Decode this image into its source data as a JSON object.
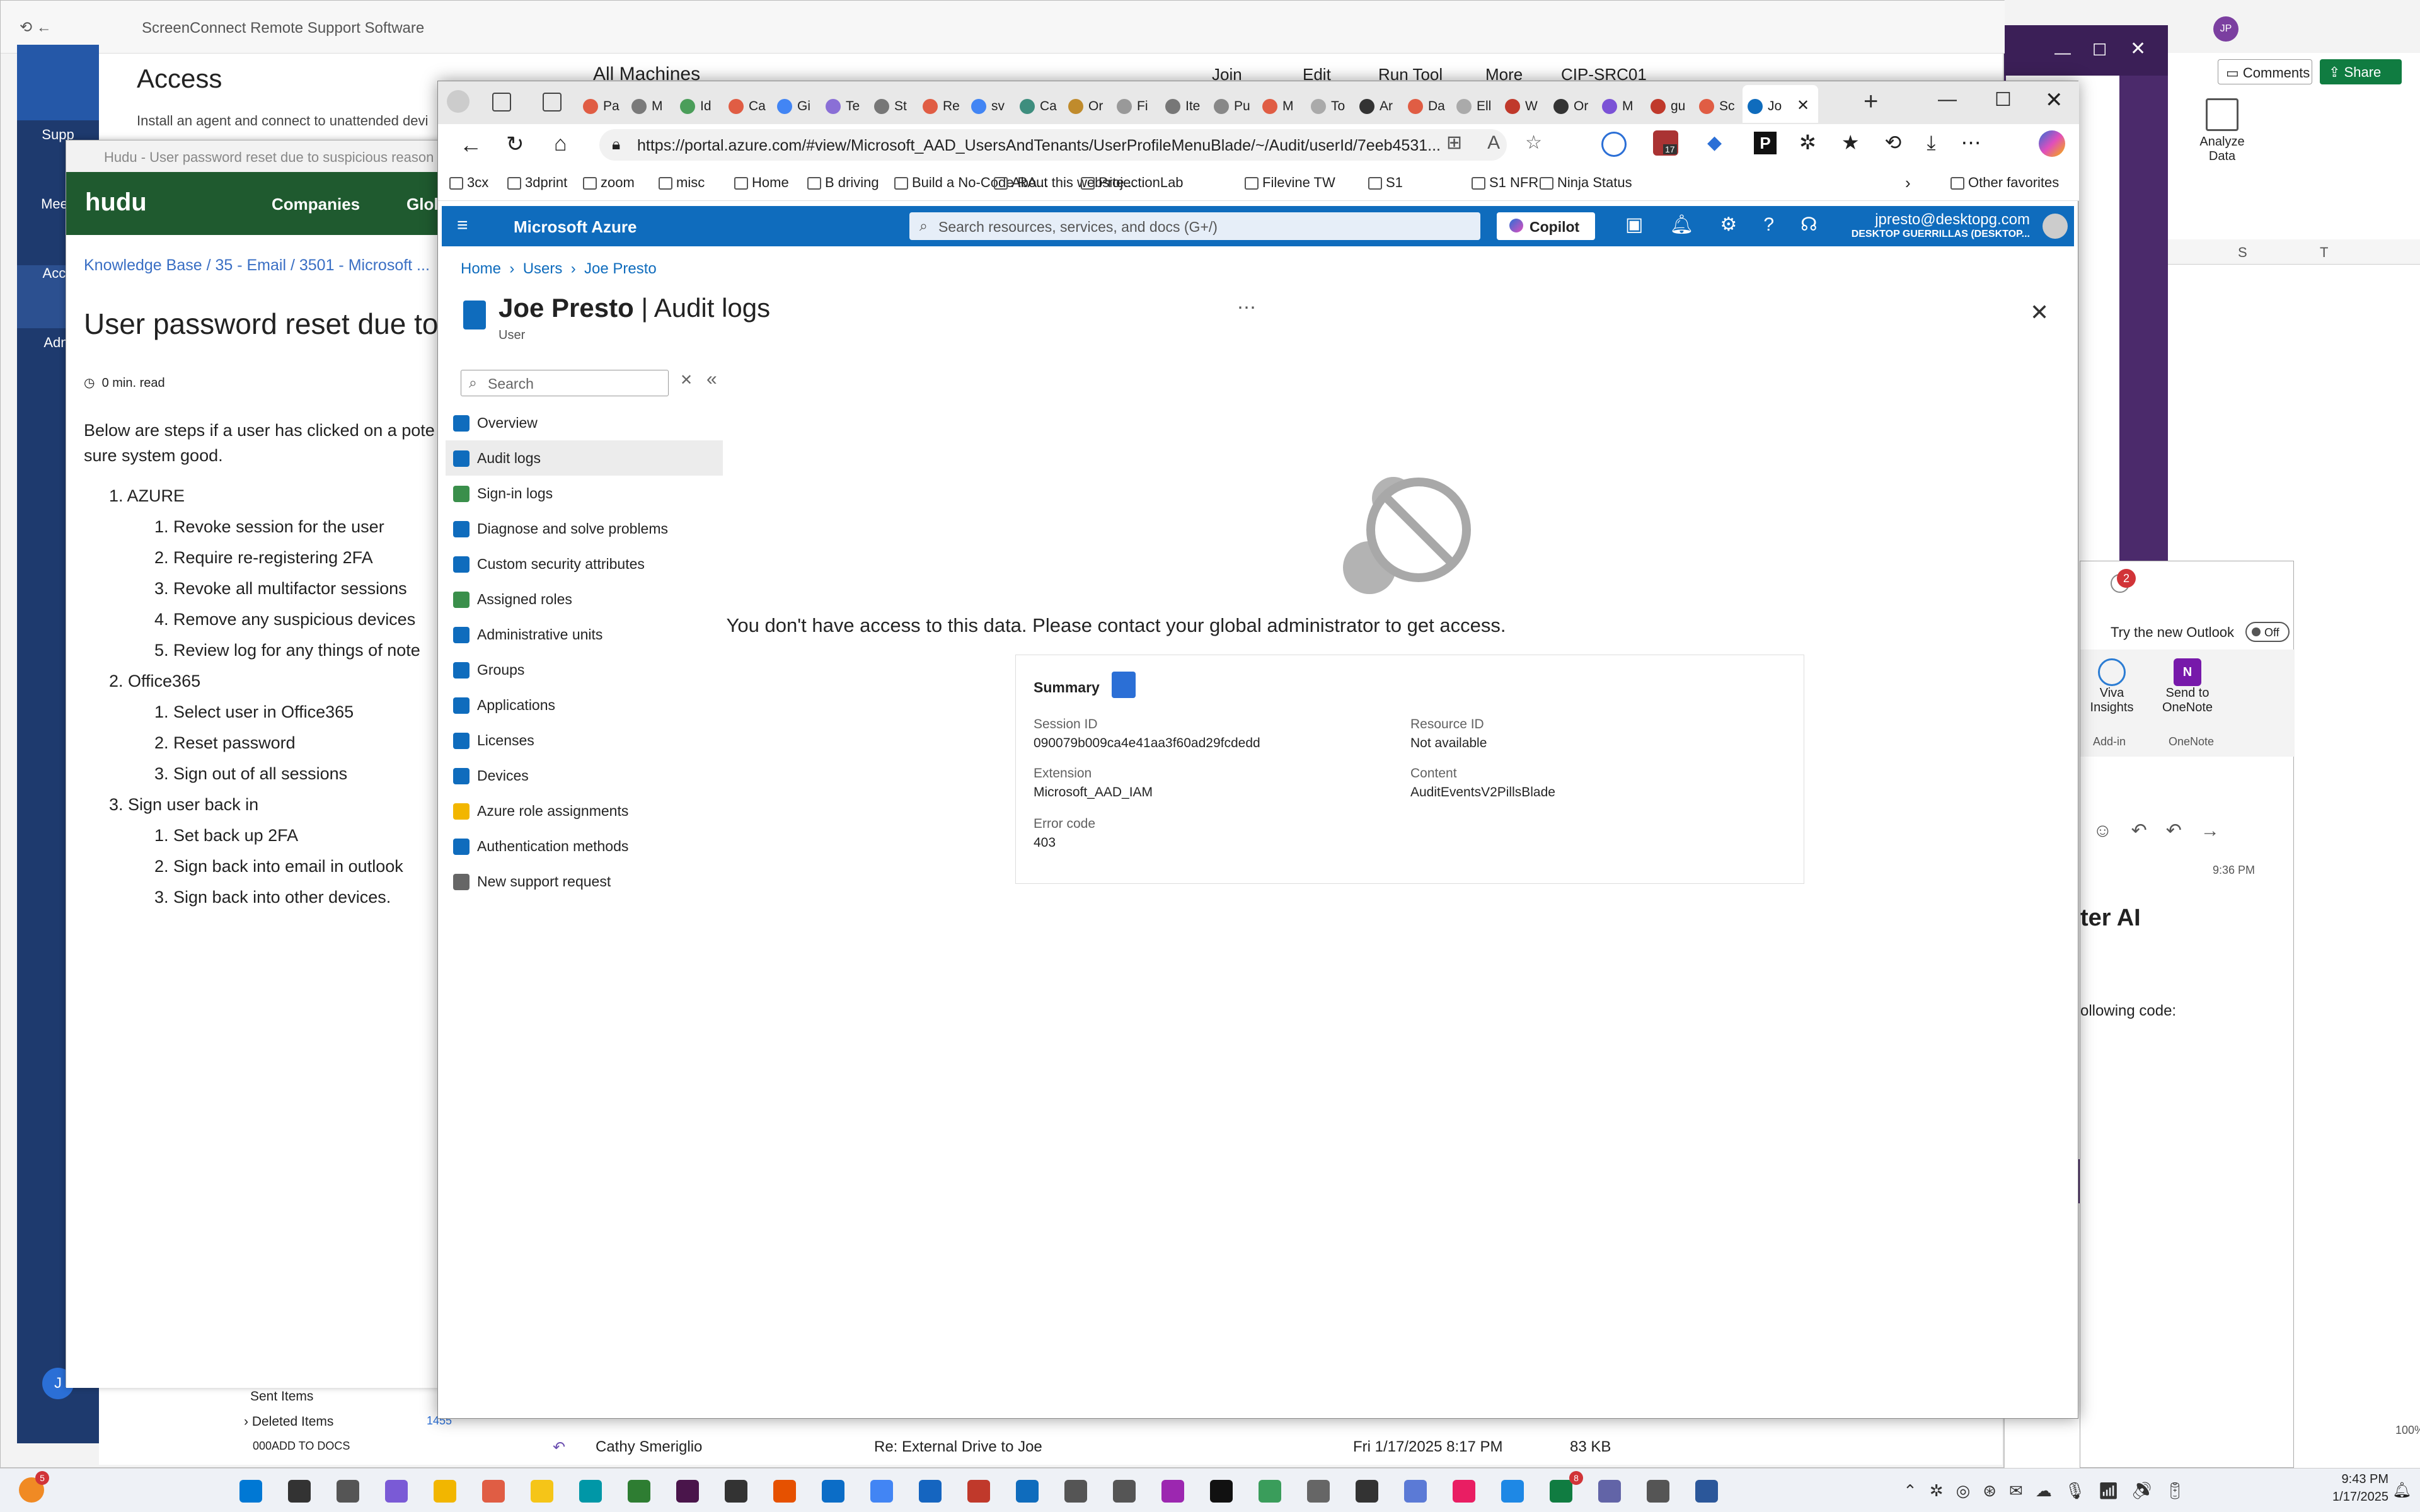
{
  "screenconnect": {
    "window_title": "ScreenConnect Remote Support Software",
    "heading": "Access",
    "subtitle": "Install an agent and connect to unattended devi",
    "nav": [
      "Supp",
      "Meeti",
      "Acce",
      "Adm"
    ],
    "machines_label": "All Machines",
    "toolbar": {
      "join": "Join",
      "edit": "Edit",
      "run_tool": "Run Tool",
      "more": "More",
      "machine": "CIP-SRC01"
    }
  },
  "hudu": {
    "window_title": "Hudu - User password reset due to suspicious reason - Desk",
    "logo": "hudu",
    "nav": {
      "companies": "Companies",
      "global": "Glol"
    },
    "breadcrumb": [
      "Knowledge Base",
      "35 - Email",
      "3501 - Microsoft ..."
    ],
    "title": "User password reset due to s",
    "read_time": "0 min. read",
    "intro": "Below are steps if a user has clicked on a pote sure system good.",
    "sections": [
      {
        "title": "AZURE",
        "items": [
          "Revoke session for the user",
          "Require re-registering 2FA",
          "Revoke all multifactor sessions",
          "Remove any suspicious devices",
          "Review log for any things of note"
        ]
      },
      {
        "title": "Office365",
        "items": [
          "Select user in Office365",
          "Reset password",
          "Sign out of all sessions"
        ]
      },
      {
        "title": "Sign user back in",
        "items": [
          "Set back up 2FA",
          "Sign back into email in outlook",
          "Sign back into other devices."
        ]
      }
    ]
  },
  "browser": {
    "tabs": [
      "Pa",
      "M",
      "Id",
      "Ca",
      "Gi",
      "Te",
      "St",
      "Re",
      "sv",
      "Ca",
      "Or",
      "Fi",
      "Ite",
      "Pu",
      "M",
      "To",
      "Ar",
      "Da",
      "Ell",
      "W",
      "Or",
      "M",
      "gu",
      "Sc",
      "Jo"
    ],
    "url": "https://portal.azure.com/#view/Microsoft_AAD_UsersAndTenants/UserProfileMenuBlade/~/Audit/userId/7eeb4531...",
    "badge_count": "17",
    "favorites": [
      "3cx",
      "3dprint",
      "zoom",
      "misc",
      "Home",
      "B driving",
      "Build a No-Code RA...",
      "About this website...",
      "ProjectionLab",
      "Filevine TW",
      "S1",
      "S1 NFR",
      "Ninja Status"
    ],
    "other_favorites": "Other favorites"
  },
  "azure": {
    "brand": "Microsoft Azure",
    "search_placeholder": "Search resources, services, and docs (G+/)",
    "copilot": "Copilot",
    "account_email": "jpresto@desktopg.com",
    "account_org": "DESKTOP GUERRILLAS (DESKTOP...",
    "breadcrumb": [
      "Home",
      "Users",
      "Joe Presto"
    ],
    "page_title": "Joe Presto",
    "page_sub": "Audit logs",
    "page_type": "User",
    "menu_search_placeholder": "Search",
    "menu": [
      "Overview",
      "Audit logs",
      "Sign-in logs",
      "Diagnose and solve problems",
      "Custom security attributes",
      "Assigned roles",
      "Administrative units",
      "Groups",
      "Applications",
      "Licenses",
      "Devices",
      "Azure role assignments",
      "Authentication methods",
      "New support request"
    ],
    "message": "You don't have access to this data. Please contact your global administrator to get access.",
    "summary": {
      "title": "Summary",
      "session_label": "Session ID",
      "session_value": "090079b009ca4e41aa3f60ad29fcdedd",
      "resource_label": "Resource ID",
      "resource_value": "Not available",
      "extension_label": "Extension",
      "extension_value": "Microsoft_AAD_IAM",
      "content_label": "Content",
      "content_value": "AuditEventsV2PillsBlade",
      "error_label": "Error code",
      "error_value": "403"
    }
  },
  "right": {
    "comments": "Comments",
    "share": "Share",
    "analyze": "Analyze Data",
    "cols": [
      "S",
      "T"
    ],
    "outlook_new": "Try the new Outlook",
    "toggle": "Off",
    "viva": "Viva Insights",
    "addin": "Add-in",
    "onenote_send": "Send to OneNote",
    "onenote": "OneNote",
    "notif_count": "2",
    "time": "9:36 PM",
    "heading_frag": "ter AI",
    "body_frag": "ollowing code:",
    "zoom": "100%"
  },
  "mail": {
    "sent": "Sent Items",
    "deleted": "Deleted Items",
    "deleted_count": "1455",
    "folder": "000ADD TO DOCS",
    "row_sender": "Cathy Smeriglio",
    "row_subject": "Re: External Drive to Joe",
    "row_date": "Fri 1/17/2025 8:17 PM",
    "row_size": "83 KB"
  },
  "taskbar": {
    "clock_time": "9:43 PM",
    "clock_date": "1/17/2025",
    "badge_weather": "5",
    "badge_teams": "8"
  }
}
